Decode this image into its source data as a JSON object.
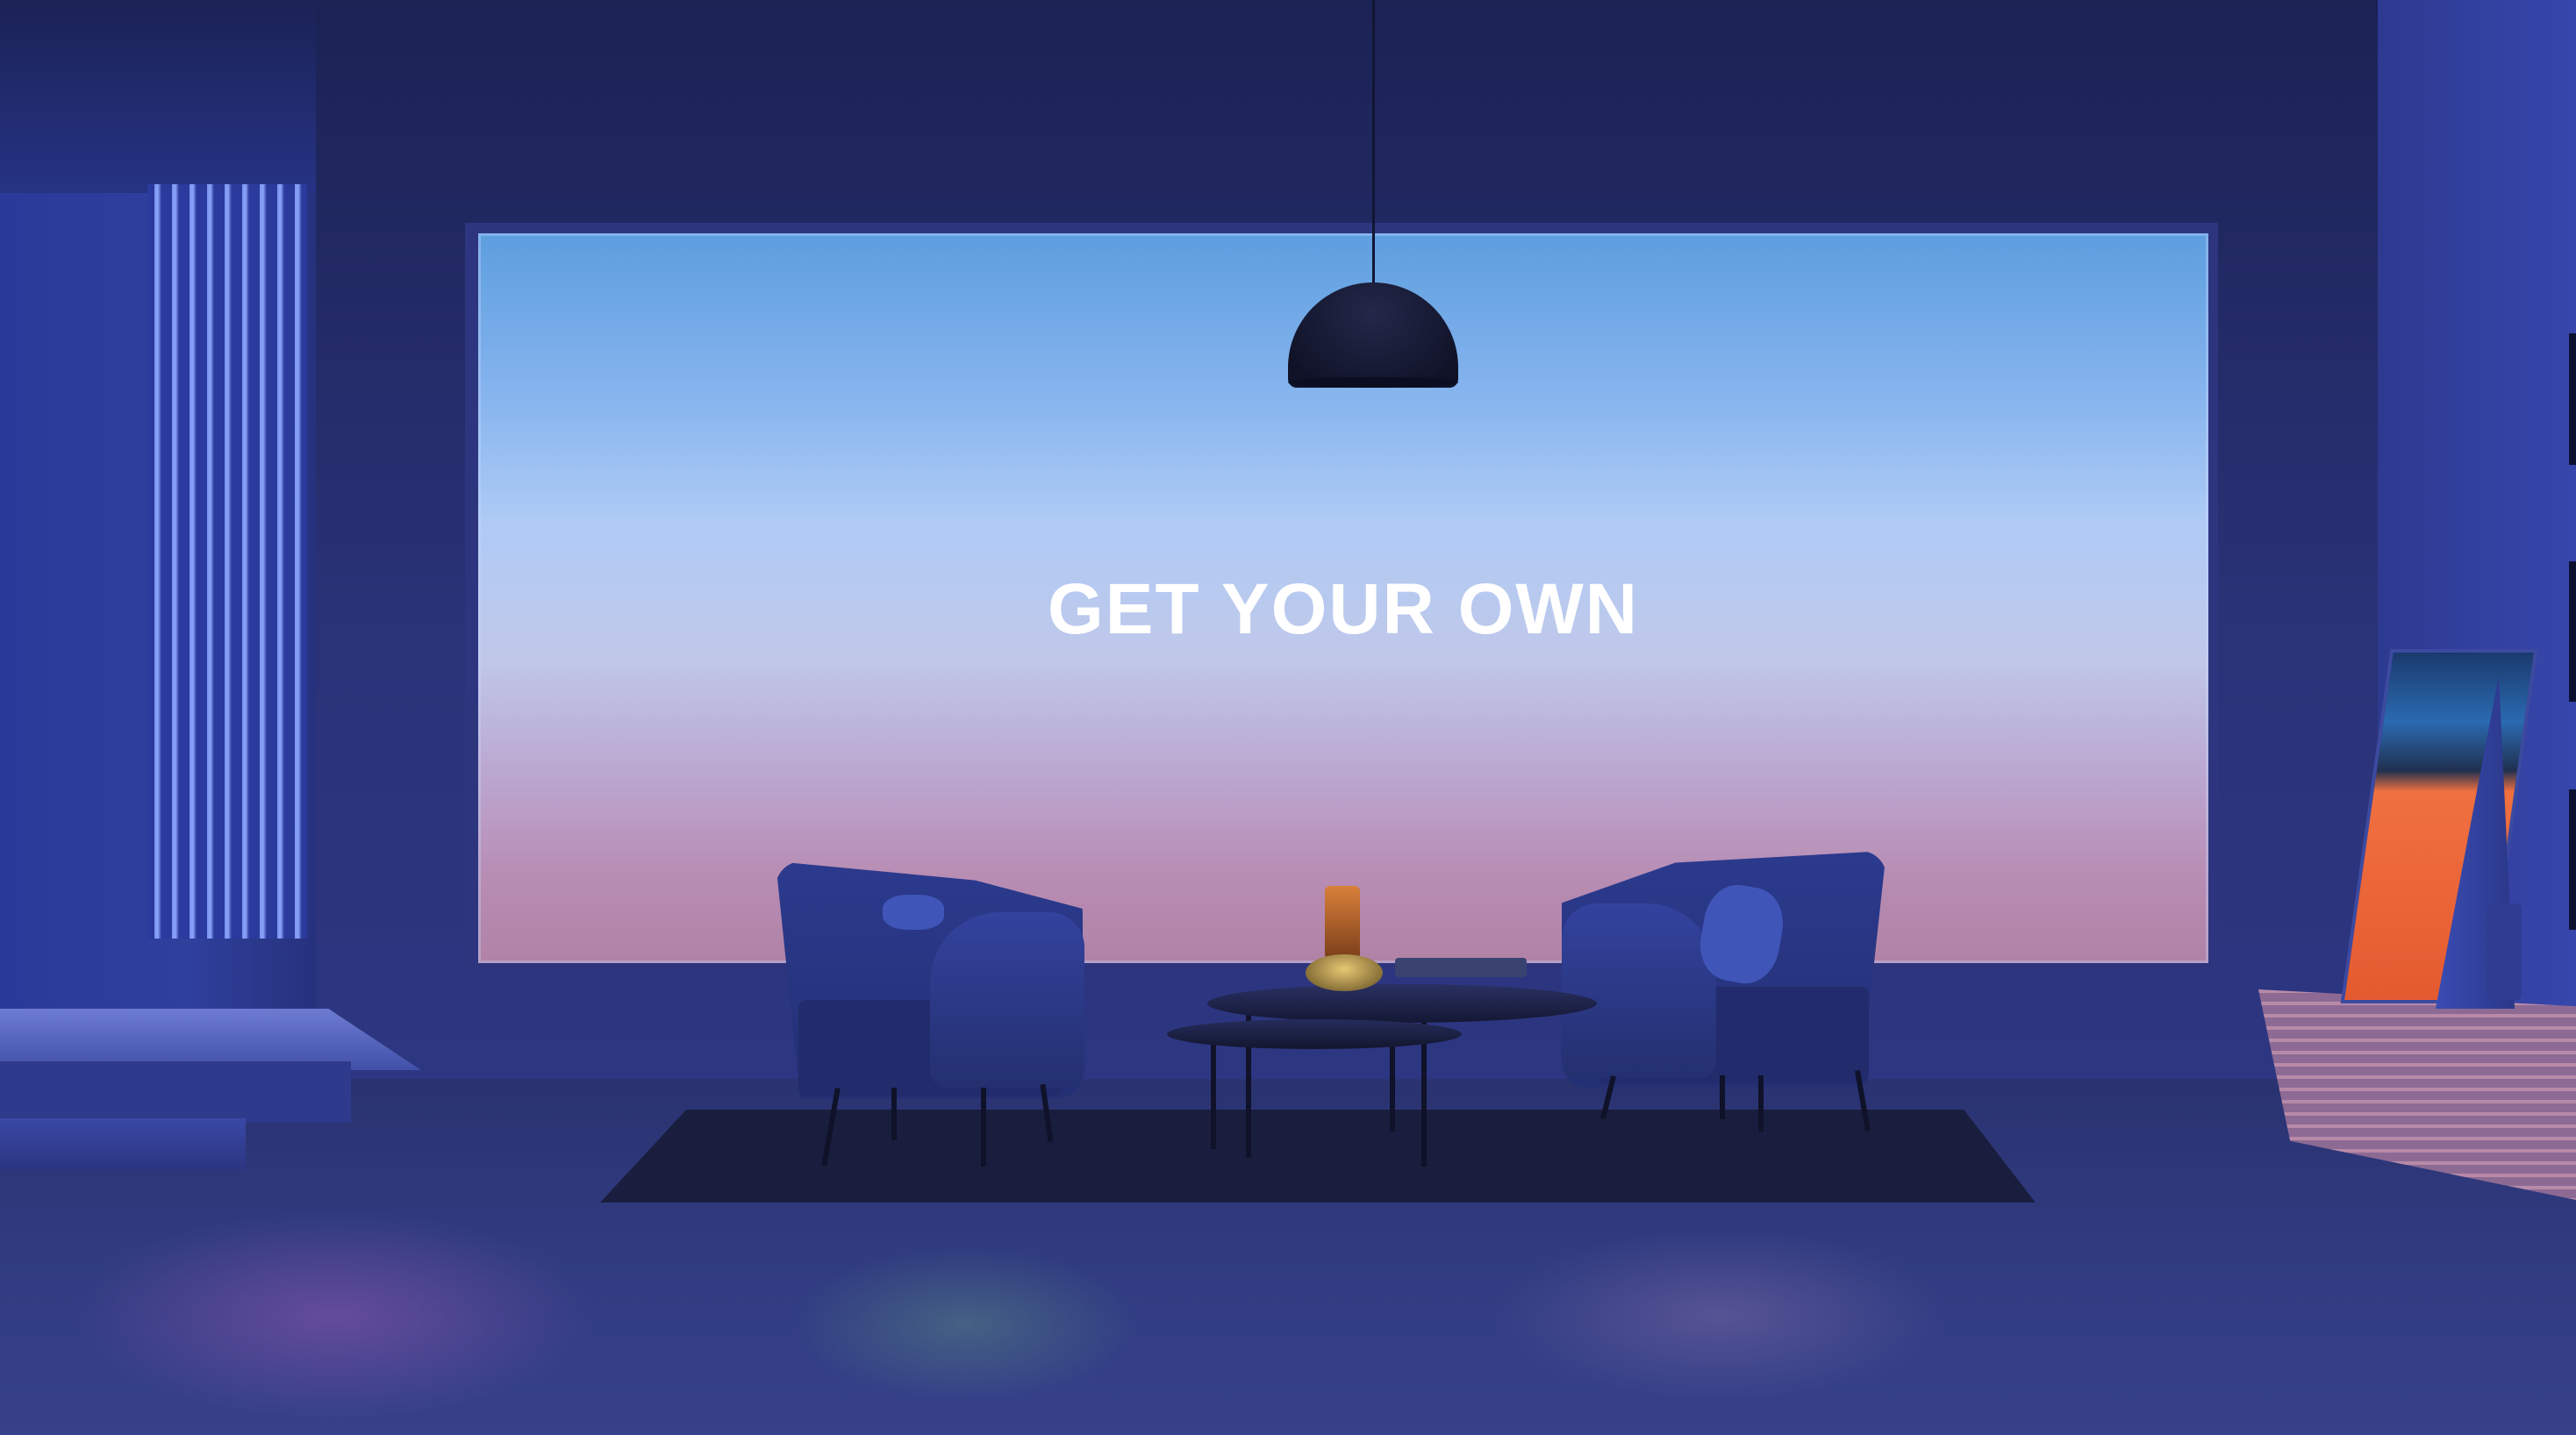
{
  "scene": {
    "headline": "GET YOUR OWN"
  }
}
